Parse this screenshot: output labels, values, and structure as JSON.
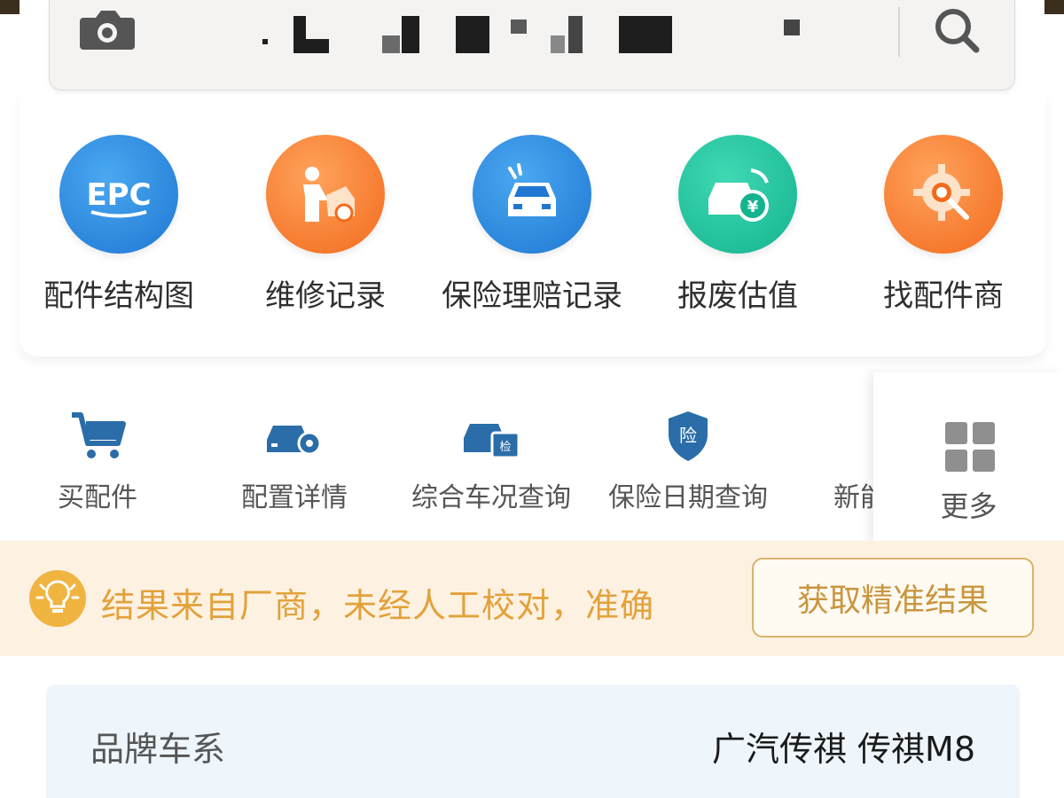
{
  "search": {
    "camera_icon": "camera-icon",
    "search_icon": "search-icon"
  },
  "features": [
    {
      "label": "配件结构图",
      "icon": "epc-icon",
      "icon_text": "EPC",
      "color": "#2a86de"
    },
    {
      "label": "维修记录",
      "icon": "repair-icon",
      "color": "#f47a2a"
    },
    {
      "label": "保险理赔记录",
      "icon": "insurance-car-icon",
      "color": "#2a86de"
    },
    {
      "label": "报废估值",
      "icon": "scrap-value-icon",
      "icon_text": "¥",
      "color": "#1fbf98"
    },
    {
      "label": "找配件商",
      "icon": "find-supplier-icon",
      "color": "#f47a2a"
    }
  ],
  "tools": [
    {
      "label": "买配件",
      "icon": "cart-icon"
    },
    {
      "label": "配置详情",
      "icon": "car-config-icon"
    },
    {
      "label": "综合车况查询",
      "icon": "car-check-icon",
      "icon_text": "检"
    },
    {
      "label": "保险日期查询",
      "icon": "insurance-shield-icon",
      "icon_text": "险"
    },
    {
      "label": "新能",
      "icon": "new-energy-icon"
    }
  ],
  "more": {
    "label": "更多",
    "icon": "grid-icon"
  },
  "notice": {
    "text": "结果来自厂商，未经人工校对，准确",
    "button": "获取精准结果",
    "icon": "bulb-icon"
  },
  "info": {
    "key": "品牌车系",
    "value": "广汽传祺 传祺M8"
  },
  "colors": {
    "accent_blue": "#1f77d3",
    "accent_orange": "#f26a1d",
    "accent_green": "#14b38e",
    "notice_text": "#e2a23a",
    "notice_bg": "#fdf1e2",
    "tool_icon": "#2a6da8"
  }
}
